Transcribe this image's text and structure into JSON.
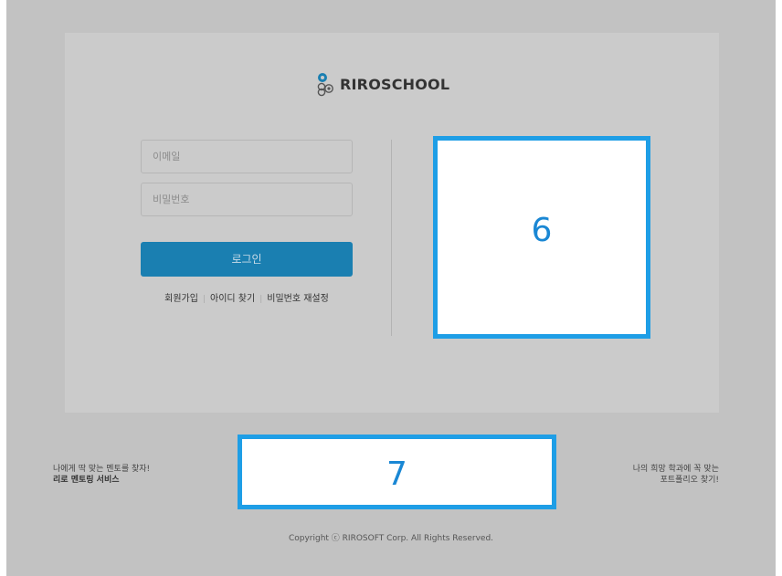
{
  "brand": {
    "logo_text": "RIROSCHOOL"
  },
  "login": {
    "email_placeholder": "이메일",
    "password_placeholder": "비밀번호",
    "login_label": "로그인",
    "links": [
      "회원가입",
      "아이디 찾기",
      "비밀번호 재설정"
    ]
  },
  "placeholders": {
    "box_a": "6",
    "box_b": "7"
  },
  "promo_left": {
    "line1": "나에게 딱 맞는 멘토를 찾자!",
    "line2": "리로 멘토링 서비스"
  },
  "promo_right": {
    "line1": "나의 희망 학과에 꼭 맞는",
    "line2": "포트폴리오 찾기!"
  },
  "footer": {
    "copyright": "Copyright ⓒ RIROSOFT Corp. All Rights Reserved."
  },
  "colors": {
    "accent": "#1a7fb1",
    "highlight_border": "#1e9ee6",
    "background": "#c2c2c2"
  }
}
